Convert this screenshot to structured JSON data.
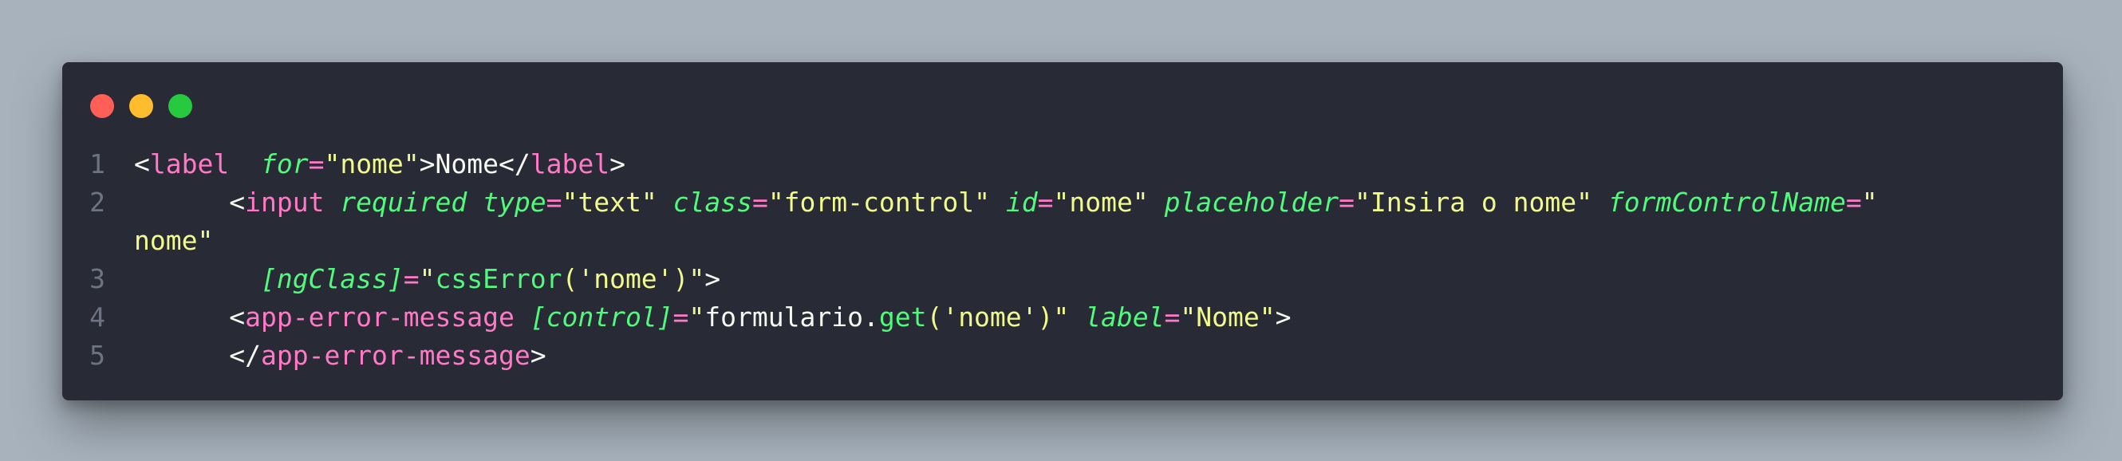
{
  "window": {
    "controls": [
      "close",
      "minimize",
      "maximize"
    ]
  },
  "colors": {
    "background": "#a7b2bd",
    "window": "#282a36",
    "tag": "#ff79c6",
    "attribute": "#50fa7b",
    "string": "#f1fa8c",
    "text": "#f8f8f2",
    "line_number": "#6e7382"
  },
  "code": {
    "line_numbers": [
      "1",
      "2",
      "3",
      "4",
      "5"
    ],
    "l1": {
      "open": "<",
      "tag": "label",
      "sp1": " ",
      "attr_for": "for",
      "eq": "=",
      "val_for": "\"nome\"",
      "gt": ">",
      "text": "Nome",
      "close_open": "</",
      "tag_close": "label",
      "close_gt": ">"
    },
    "l2": {
      "indent": "      ",
      "open": "<",
      "tag": "input",
      "attr_required": "required",
      "attr_type": "type",
      "val_type": "\"text\"",
      "attr_class": "class",
      "val_class": "\"form-control\"",
      "attr_id": "id",
      "val_id": "\"nome\"",
      "attr_placeholder": "placeholder",
      "val_placeholder": "\"Insira o nome\"",
      "attr_fcn": "formControlName",
      "val_fcn_start": "\"",
      "val_fcn_end": "nome\""
    },
    "l3": {
      "indent": "        ",
      "attr_ngclass": "[ngClass]",
      "eq": "=",
      "q1": "\"",
      "fn": "cssError",
      "args": "('nome')",
      "q2": "\"",
      "gt": ">"
    },
    "l4": {
      "indent": "      ",
      "open": "<",
      "tag": "app-error-message",
      "attr_control": "[control]",
      "q1": "\"",
      "obj": "formulario.",
      "fn": "get",
      "args": "('nome')",
      "q2": "\"",
      "attr_label": "label",
      "val_label": "\"Nome\"",
      "gt": ">"
    },
    "l5": {
      "indent": "      ",
      "close_open": "</",
      "tag": "app-error-message",
      "gt": ">"
    }
  }
}
